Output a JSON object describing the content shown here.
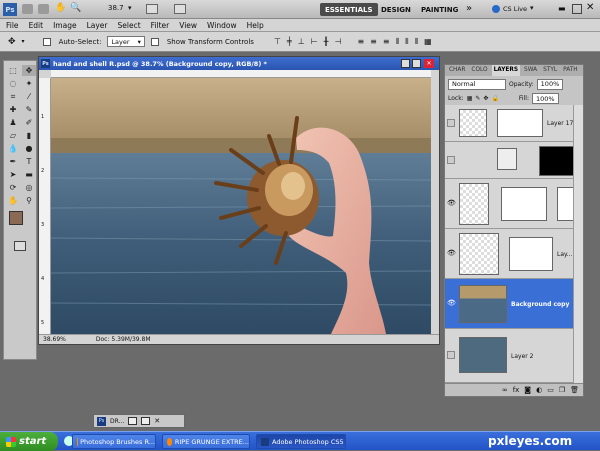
{
  "app_bar": {
    "ps_logo": "Ps",
    "zoom": "38.7",
    "workspaces": [
      "ESSENTIALS",
      "DESIGN",
      "PAINTING"
    ],
    "more": "»",
    "cs_live": "CS Live"
  },
  "menu": [
    "File",
    "Edit",
    "Image",
    "Layer",
    "Select",
    "Filter",
    "View",
    "Window",
    "Help"
  ],
  "options": {
    "auto_select_label": "Auto-Select:",
    "auto_select_value": "Layer",
    "transform_label": "Show Transform Controls"
  },
  "document": {
    "icon": "Ps",
    "title": "hand and shell R.psd @ 38.7% (Background copy, RGB/8) *",
    "zoom_field": "38.69%",
    "doc_info": "Doc: 5.39M/39.8M",
    "ruler_left": [
      "1",
      "2",
      "3",
      "4",
      "5"
    ]
  },
  "layers_panel": {
    "tabs": [
      "CHAR",
      "COLO",
      "LAYERS",
      "SWA",
      "STYL",
      "PATH"
    ],
    "blend_mode": "Normal",
    "opacity_label": "Opacity:",
    "opacity_value": "100%",
    "lock_label": "Lock:",
    "fill_label": "Fill:",
    "fill_value": "100%",
    "layers": [
      {
        "name": "Layer 17",
        "selected": false
      },
      {
        "name": "",
        "selected": false
      },
      {
        "name": "",
        "selected": false
      },
      {
        "name": "Lay...",
        "selected": false
      },
      {
        "name": "Background copy",
        "selected": true
      },
      {
        "name": "Layer 2",
        "selected": false
      }
    ],
    "footer_icons": [
      "link-icon",
      "fx-icon",
      "mask-icon",
      "adjustment-icon",
      "folder-icon",
      "new-layer-icon",
      "trash-icon"
    ]
  },
  "mini_doc": {
    "icon": "Ps",
    "label": "DR..."
  },
  "taskbar": {
    "start": "start",
    "tasks": [
      {
        "label": "Photoshop Brushes R...",
        "active": false
      },
      {
        "label": "RIPE GRUNGE EXTRE...",
        "active": false
      },
      {
        "label": "Adobe Photoshop CS5",
        "active": true
      }
    ],
    "brand": "pxleyes.com"
  },
  "colors": {
    "title_blue": "#2a54b0",
    "selected_layer": "#3a6fd6",
    "foreground_swatch": "#8a6a55",
    "taskbar_blue": "#2354c7"
  }
}
